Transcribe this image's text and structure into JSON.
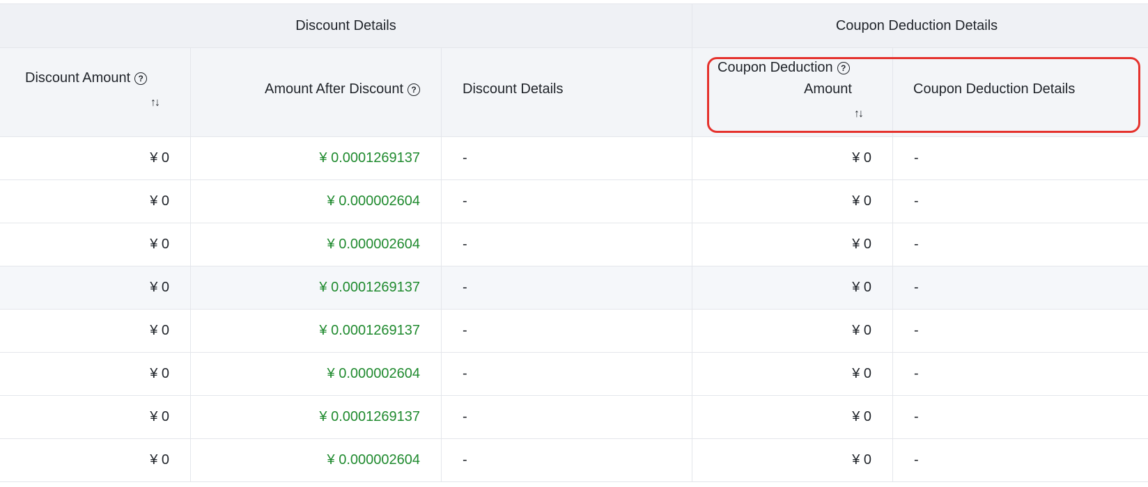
{
  "group_headers": {
    "discount": "Discount Details",
    "coupon": "Coupon Deduction Details"
  },
  "columns": {
    "discount_amount": "Discount Amount",
    "amount_after_discount": "Amount After Discount",
    "discount_details": "Discount Details",
    "coupon_deduction_amount_line1": "Coupon Deduction",
    "coupon_deduction_amount_line2": "Amount",
    "coupon_deduction_details": "Coupon Deduction Details"
  },
  "icons": {
    "help": "question-circle-icon",
    "sort": "sort-toggle-icon"
  },
  "colors": {
    "amount_after_discount": "#1f8a2e",
    "highlight": "#e5322d",
    "header_bg": "#f3f5f8"
  },
  "rows": [
    {
      "discount_amount": "¥ 0",
      "amount_after_discount": "¥ 0.0001269137",
      "discount_details": "-",
      "coupon_deduction_amount": "¥ 0",
      "coupon_deduction_details": "-"
    },
    {
      "discount_amount": "¥ 0",
      "amount_after_discount": "¥ 0.000002604",
      "discount_details": "-",
      "coupon_deduction_amount": "¥ 0",
      "coupon_deduction_details": "-"
    },
    {
      "discount_amount": "¥ 0",
      "amount_after_discount": "¥ 0.000002604",
      "discount_details": "-",
      "coupon_deduction_amount": "¥ 0",
      "coupon_deduction_details": "-"
    },
    {
      "discount_amount": "¥ 0",
      "amount_after_discount": "¥ 0.0001269137",
      "discount_details": "-",
      "coupon_deduction_amount": "¥ 0",
      "coupon_deduction_details": "-"
    },
    {
      "discount_amount": "¥ 0",
      "amount_after_discount": "¥ 0.0001269137",
      "discount_details": "-",
      "coupon_deduction_amount": "¥ 0",
      "coupon_deduction_details": "-"
    },
    {
      "discount_amount": "¥ 0",
      "amount_after_discount": "¥ 0.000002604",
      "discount_details": "-",
      "coupon_deduction_amount": "¥ 0",
      "coupon_deduction_details": "-"
    },
    {
      "discount_amount": "¥ 0",
      "amount_after_discount": "¥ 0.0001269137",
      "discount_details": "-",
      "coupon_deduction_amount": "¥ 0",
      "coupon_deduction_details": "-"
    },
    {
      "discount_amount": "¥ 0",
      "amount_after_discount": "¥ 0.000002604",
      "discount_details": "-",
      "coupon_deduction_amount": "¥ 0",
      "coupon_deduction_details": "-"
    }
  ]
}
